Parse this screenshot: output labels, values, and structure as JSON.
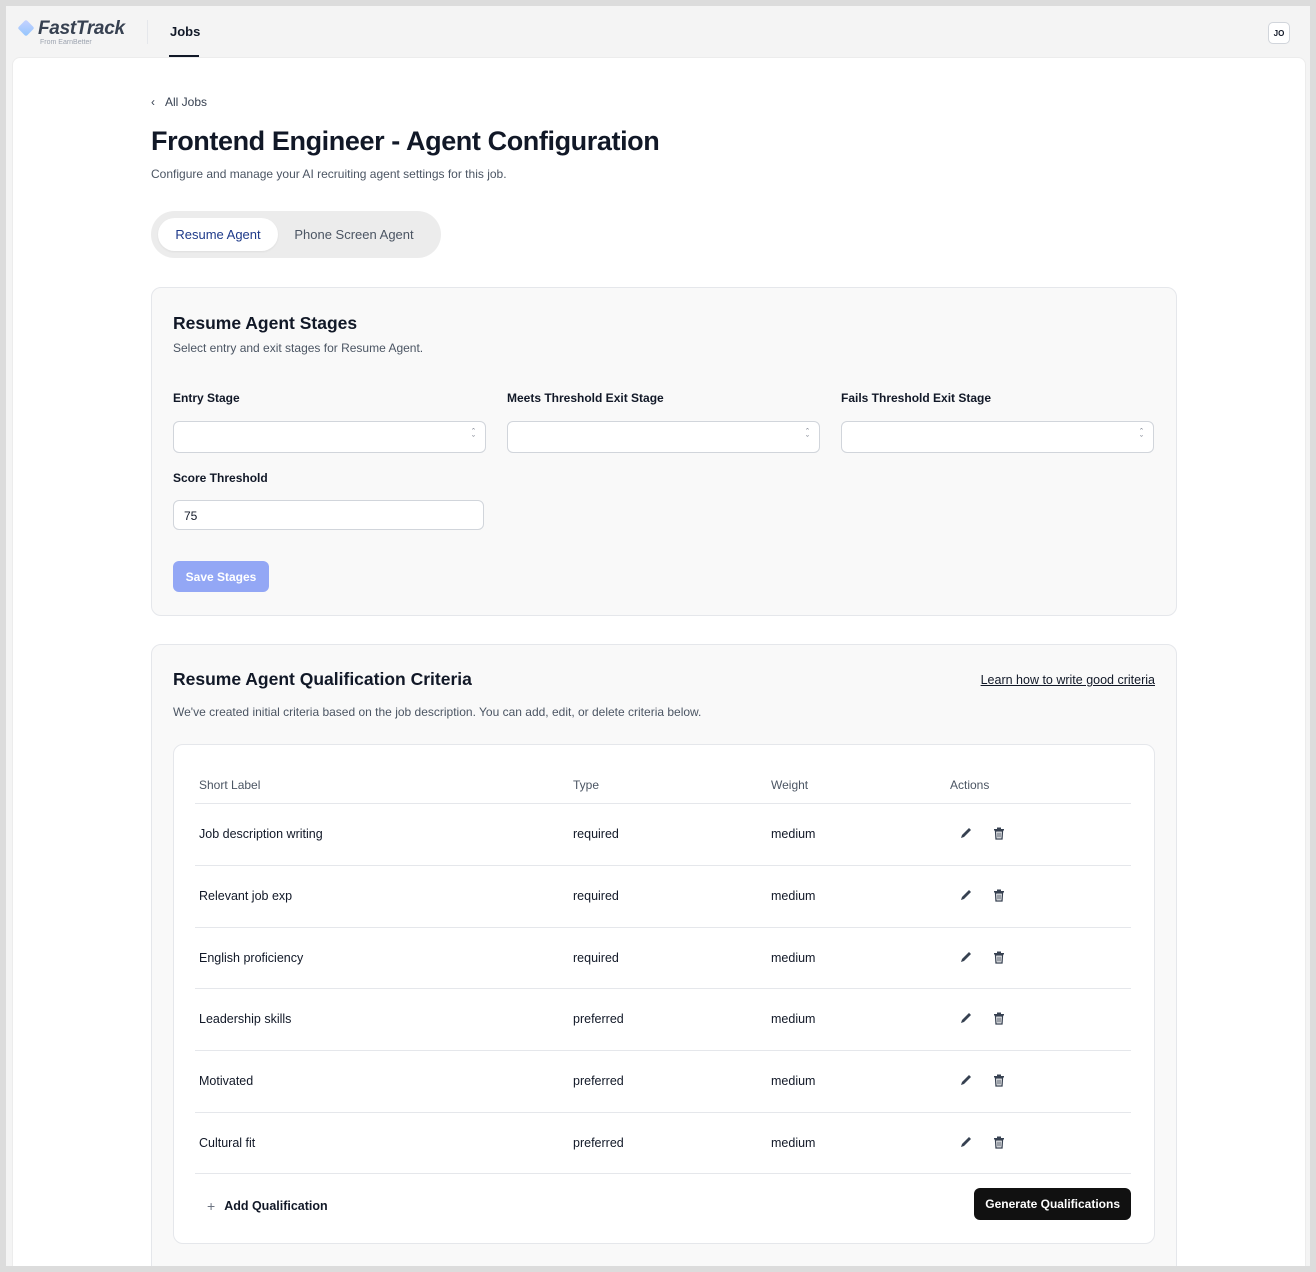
{
  "app": {
    "brand": "FastTrack",
    "brand_sub": "From EarnBetter",
    "nav_jobs": "Jobs",
    "avatar_initials": "JO"
  },
  "breadcrumb": {
    "back_label": "All Jobs"
  },
  "page": {
    "title": "Frontend Engineer - Agent Configuration",
    "subtitle": "Configure and manage your AI recruiting agent settings for this job."
  },
  "tabs": [
    {
      "label": "Resume Agent",
      "active": true
    },
    {
      "label": "Phone Screen Agent",
      "active": false
    }
  ],
  "stages": {
    "title": "Resume Agent Stages",
    "subtitle": "Select entry and exit stages for Resume Agent.",
    "entry_label": "Entry Stage",
    "entry_value": "",
    "meets_label": "Meets Threshold Exit Stage",
    "meets_value": "",
    "fails_label": "Fails Threshold Exit Stage",
    "fails_value": "",
    "threshold_label": "Score Threshold",
    "threshold_value": "75",
    "save_label": "Save Stages"
  },
  "criteria": {
    "title": "Resume Agent Qualification Criteria",
    "subtitle": "We've created initial criteria based on the job description. You can add, edit, or delete criteria below.",
    "learn_link": "Learn how to write good criteria",
    "columns": [
      "Short Label",
      "Type",
      "Weight",
      "Actions"
    ],
    "rows": [
      {
        "label": "Job description writing",
        "type": "required",
        "weight": "medium"
      },
      {
        "label": "Relevant job exp",
        "type": "required",
        "weight": "medium"
      },
      {
        "label": "English proficiency",
        "type": "required",
        "weight": "medium"
      },
      {
        "label": "Leadership skills",
        "type": "preferred",
        "weight": "medium"
      },
      {
        "label": "Motivated",
        "type": "preferred",
        "weight": "medium"
      },
      {
        "label": "Cultural fit",
        "type": "preferred",
        "weight": "medium"
      }
    ],
    "add_label": "Add Qualification",
    "generate_label": "Generate Qualifications"
  },
  "colors": {
    "accent_tab_text": "#1e3a8a",
    "save_button_disabled": "#93a7f5",
    "primary_dark": "#111111"
  },
  "icons": [
    "back-chevron-icon",
    "select-arrows-icon",
    "edit-pencil-icon",
    "trash-icon",
    "plus-icon"
  ]
}
